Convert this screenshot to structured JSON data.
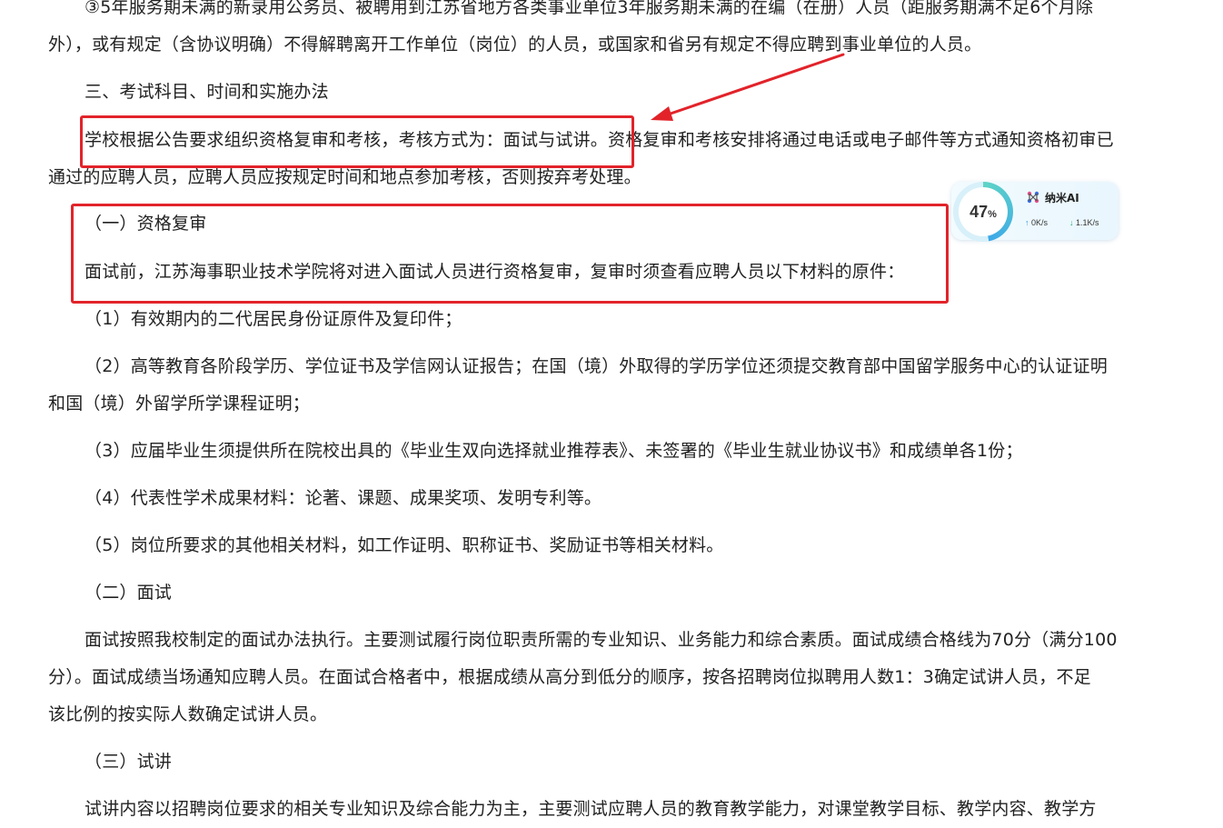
{
  "doc": {
    "p1_l1": "③5年服务期未满的新录用公务员、被聘用到江苏省地方各类事业单位3年服务期未满的在编（在册）人员（距服务期满不足6个月除",
    "p1_l2": "外），或有规定（含协议明确）不得解聘离开工作单位（岗位）的人员，或国家和省另有规定不得应聘到事业单位的人员。",
    "h3": "三、考试科目、时间和实施办法",
    "p2_l1a": "学校根据公告要求组织资格复审和考核，考核方式为：面试与试讲。",
    "p2_l1b": "资格复审和考核安排将通过电话或电子邮件等方式通知资格初审已",
    "p2_l2": "通过的应聘人员，应聘人员应按规定时间和地点参加考核，否则按弃考处理。",
    "s1_title": "（一）资格复审",
    "s1_body": "面试前，江苏海事职业技术学院将对进入面试人员进行资格复审，复审时须查看应聘人员以下材料的原件：",
    "item1": "（1）有效期内的二代居民身份证原件及复印件；",
    "item2_l1": "（2）高等教育各阶段学历、学位证书及学信网认证报告；在国（境）外取得的学历学位还须提交教育部中国留学服务中心的认证证明",
    "item2_l2": "和国（境）外留学所学课程证明；",
    "item3": "（3）应届毕业生须提供所在院校出具的《毕业生双向选择就业推荐表》、未签署的《毕业生就业协议书》和成绩单各1份；",
    "item4": "（4）代表性学术成果材料：论著、课题、成果奖项、发明专利等。",
    "item5": "（5）岗位所要求的其他相关材料，如工作证明、职称证书、奖励证书等相关材料。",
    "s2_title": "（二）面试",
    "s2_l1": "面试按照我校制定的面试办法执行。主要测试履行岗位职责所需的专业知识、业务能力和综合素质。面试成绩合格线为70分（满分100",
    "s2_l2": "分）。面试成绩当场通知应聘人员。在面试合格者中，根据成绩从高分到低分的顺序，按各招聘岗位拟聘用人数1：3确定试讲人员，不足",
    "s2_l3": "该比例的按实际人数确定试讲人员。",
    "s3_title": "（三）试讲",
    "s3_l1": "试讲内容以招聘岗位要求的相关专业知识及综合能力为主，主要测试应聘人员的教育教学能力，对课堂教学目标、教学内容、教学方"
  },
  "widget": {
    "percent": "47",
    "percent_unit": "%",
    "brand": "纳米AI",
    "upload": "0K/s",
    "download": "1.1K/s",
    "progress_fraction": 0.47
  },
  "colors": {
    "annotation_red": "#e2232a",
    "text": "#222222",
    "accent_blue": "#3da9e8",
    "accent_teal": "#5fd4c6"
  }
}
